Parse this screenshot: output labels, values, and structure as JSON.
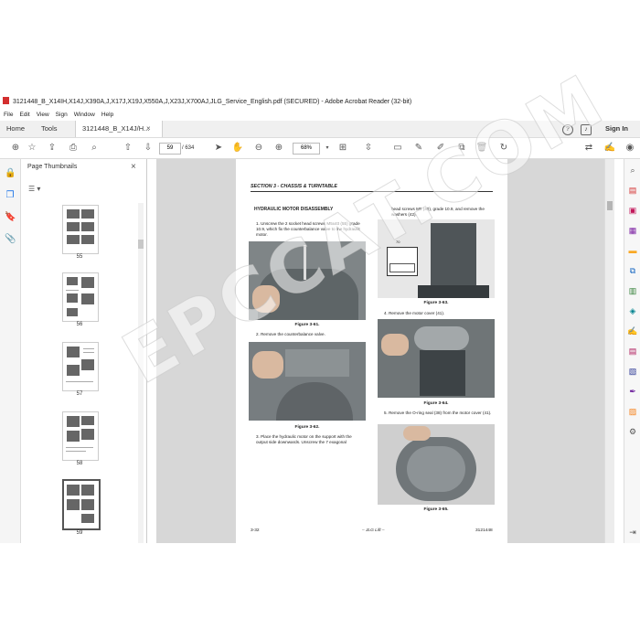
{
  "window": {
    "title": "3121448_B_X14IH,X14J,X390A,J,X17J,X19J,X550A,J,X23J,X700AJ,JLG_Service_English.pdf (SECURED) - Adobe Acrobat Reader (32-bit)"
  },
  "menu": [
    "File",
    "Edit",
    "View",
    "Sign",
    "Window",
    "Help"
  ],
  "tabs": {
    "home": "Home",
    "tools": "Tools",
    "document": "3121448_B_X14J/H...",
    "close": "×",
    "signin": "Sign In"
  },
  "toolbar": {
    "page_current": "59",
    "page_total": "/ 634",
    "zoom": "68%"
  },
  "thumbnails": {
    "title": "Page Thumbnails",
    "close": "×",
    "options": "☰ ▾",
    "pages": [
      {
        "label": "55",
        "selected": false
      },
      {
        "label": "56",
        "selected": false
      },
      {
        "label": "57",
        "selected": false
      },
      {
        "label": "58",
        "selected": false
      },
      {
        "label": "59",
        "selected": true
      }
    ]
  },
  "document": {
    "section_title": "SECTION 3 - CHASSIS & TURNTABLE",
    "heading": "HYDRAULIC MOTOR DISASSEMBLY",
    "step1": "1.   Unscrew the 2 socket head screws M5x40 (55) grade 10.9, which fix the counterbalance valve to the hydraulic motor.",
    "fig1": "Figure 3-61.",
    "step2": "2.   Remove the counterbalance valve.",
    "fig2": "Figure 3-62.",
    "step3": "3.   Place the hydraulic motor on the support with the output side downwards. Unscrew the 7 exagonal",
    "cont3": "head screws M8 (40), grade 10.9, and remove the washers (42).",
    "fig3": "Figure 3-63.",
    "step4": "4.   Remove the motor cover (41).",
    "fig4": "Figure 3-64.",
    "step5": "5.   Remove the O-ring seal (38) from the motor cover (41).",
    "fig5": "Figure 3-65.",
    "dim_label": "70",
    "footer_left": "3-32",
    "footer_mid": "– JLG Lift –",
    "footer_right": "3121448",
    "watermark": "EPCCAT.COM"
  }
}
